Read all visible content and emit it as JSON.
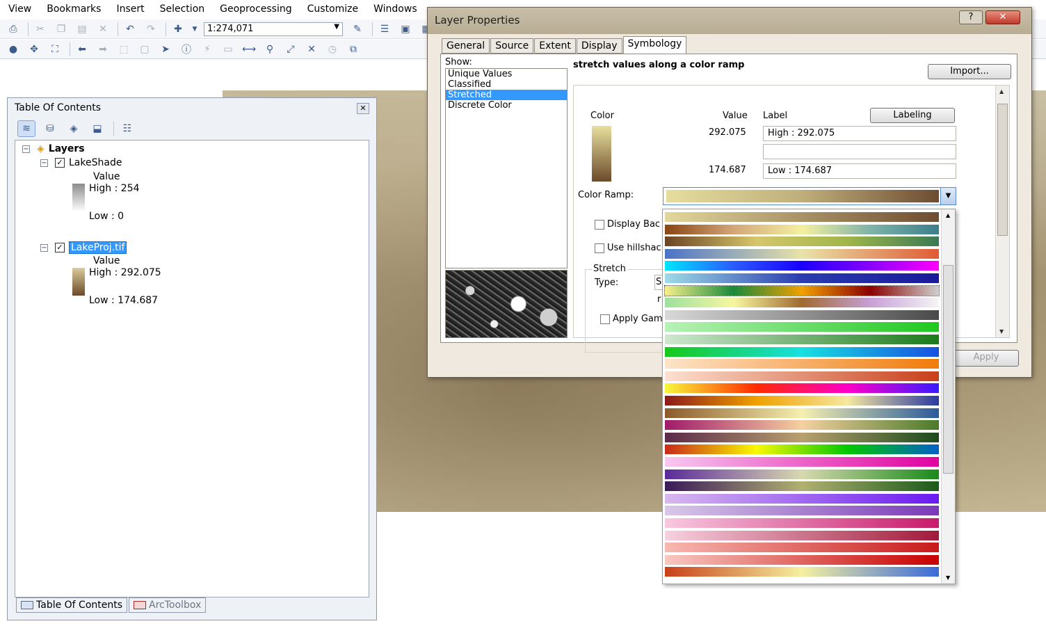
{
  "menu": [
    "View",
    "Bookmarks",
    "Insert",
    "Selection",
    "Geoprocessing",
    "Customize",
    "Windows"
  ],
  "toolbar": {
    "scale_value": "1:274,071"
  },
  "toc": {
    "title": "Table Of Contents",
    "close_glyph": "✕",
    "root_label": "Layers",
    "layers": [
      {
        "name": "LakeShade",
        "checked": true,
        "field": "Value",
        "high": "High : 254",
        "low": "Low : 0",
        "ramp": [
          "#8c8c8c",
          "#ffffff"
        ]
      },
      {
        "name": "LakeProj.tif",
        "checked": true,
        "selected": true,
        "field": "Value",
        "high": "High : 292.075",
        "low": "Low : 174.687",
        "ramp": [
          "#d9cc9a",
          "#6b4a2a"
        ]
      }
    ],
    "tabs": [
      "Table Of Contents",
      "ArcToolbox"
    ]
  },
  "dialog": {
    "title": "Layer Properties",
    "help_glyph": "?",
    "close_glyph": "✕",
    "tabs": [
      "General",
      "Source",
      "Extent",
      "Display",
      "Symbology"
    ],
    "active_tab": "Symbology",
    "show_label": "Show:",
    "show_items": [
      "Unique Values",
      "Classified",
      "Stretched",
      "Discrete Color"
    ],
    "selected_show": "Stretched",
    "heading": "stretch values along a color ramp",
    "import_label": "Import...",
    "color_header": "Color",
    "value_header": "Value",
    "label_header": "Label",
    "labeling_label": "Labeling",
    "high_value": "292.075",
    "low_value": "174.687",
    "high_label": "High : 292.075",
    "mid_label": "",
    "low_label": "Low : 174.687",
    "color_ramp_label": "Color Ramp:",
    "display_background_label": "Display Bac",
    "use_hillshade_label": "Use hillshac",
    "stretch_group_label": "Stretch",
    "type_label": "Type:",
    "type_value_partial": "S",
    "r_partial": "r",
    "apply_gamma_label": "Apply Gam",
    "apply_label": "Apply"
  },
  "color_ramps": [
    [
      "#e3d79c",
      "#6e4c30"
    ],
    [
      "#8b4513",
      "#d2a679",
      "#f5f0a0",
      "#7fb3a8",
      "#3b7f8c"
    ],
    [
      "#6b4422",
      "#d6c66b",
      "#9fb64a",
      "#3a7a54"
    ],
    [
      "#4a73c6",
      "#e8e3a8",
      "#e05a35"
    ],
    [
      "#00e5ff",
      "#2a5cff",
      "#1a00ff",
      "#8a00ff",
      "#ff00ff"
    ],
    [
      "#9edbe8",
      "#2a3cb0",
      "#1a1a9a"
    ],
    [
      "#f6f08a",
      "#1a8a3a",
      "#f0a000",
      "#8b0000",
      "#d0d0d0"
    ],
    [
      "#9ee09e",
      "#f7f7a0",
      "#a06a30",
      "#c8a0d8",
      "#f5f5f5"
    ],
    [
      "#d8d8d8",
      "#4a4a4a"
    ],
    [
      "#b8f2b8",
      "#1ec81e"
    ],
    [
      "#cfe8cf",
      "#1a7a1a"
    ],
    [
      "#18c818",
      "#18e0e0",
      "#1850e0"
    ],
    [
      "#fde4c8",
      "#f07b0a"
    ],
    [
      "#fde0d0",
      "#c8401a"
    ],
    [
      "#f8f83a",
      "#ff2a00",
      "#ff00c8",
      "#3a1aff"
    ],
    [
      "#8b1a1a",
      "#f0a000",
      "#f5e8a0",
      "#2a3aa0"
    ],
    [
      "#8b5a2a",
      "#f5f0b0",
      "#2a5a9a"
    ],
    [
      "#a01a6a",
      "#f5d0a0",
      "#4a7a2a"
    ],
    [
      "#5a2a4a",
      "#b8a070",
      "#1a4a1a"
    ],
    [
      "#c82a1a",
      "#f8f800",
      "#00c800",
      "#0060c8"
    ],
    [
      "#f8c8f0",
      "#e000a0"
    ],
    [
      "#5a2a9a",
      "#d8d8b0",
      "#1a8a1a"
    ],
    [
      "#3a1a5a",
      "#b0b070",
      "#1a5a1a"
    ],
    [
      "#d8b8f0",
      "#6a1af0"
    ],
    [
      "#d8c8e8",
      "#7a3ab8"
    ],
    [
      "#f8c8e0",
      "#c81a6a"
    ],
    [
      "#f8d0e0",
      "#a01a3a"
    ],
    [
      "#f8b8b0",
      "#c81a1a"
    ],
    [
      "#f8c8c0",
      "#c80000"
    ],
    [
      "#c8401a",
      "#f5f0a0",
      "#3a6ad8"
    ]
  ]
}
